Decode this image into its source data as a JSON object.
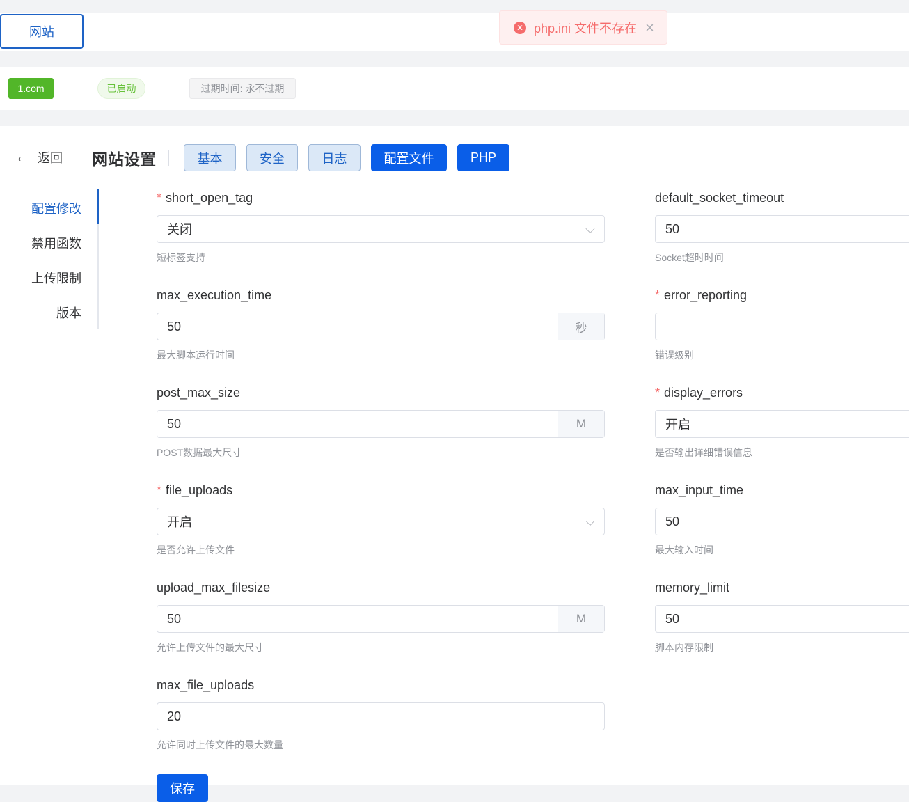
{
  "tabs": {
    "site_label": "网站"
  },
  "toast": {
    "message": "php.ini 文件不存在",
    "icon": "error-circle-icon",
    "close_icon": "close-icon"
  },
  "site": {
    "domain": "1.com",
    "status": "已启动",
    "expire": "过期时间: 永不过期"
  },
  "header": {
    "back_label": "返回",
    "title": "网站设置",
    "buttons": [
      "基本",
      "安全",
      "日志",
      "配置文件",
      "PHP"
    ]
  },
  "sidenav": [
    "配置修改",
    "禁用函数",
    "上传限制",
    "版本"
  ],
  "form": {
    "short_open_tag": {
      "label": "short_open_tag",
      "value": "关闭",
      "help": "短标签支持"
    },
    "max_execution_time": {
      "label": "max_execution_time",
      "value": "50",
      "suffix": "秒",
      "help": "最大脚本运行时间"
    },
    "post_max_size": {
      "label": "post_max_size",
      "value": "50",
      "suffix": "M",
      "help": "POST数据最大尺寸"
    },
    "file_uploads": {
      "label": "file_uploads",
      "value": "开启",
      "help": "是否允许上传文件"
    },
    "upload_max_filesize": {
      "label": "upload_max_filesize",
      "value": "50",
      "suffix": "M",
      "help": "允许上传文件的最大尺寸"
    },
    "max_file_uploads": {
      "label": "max_file_uploads",
      "value": "20",
      "help": "允许同时上传文件的最大数量"
    },
    "default_socket_timeout": {
      "label": "default_socket_timeout",
      "value": "50",
      "help": "Socket超时时间"
    },
    "error_reporting": {
      "label": "error_reporting",
      "value": "",
      "help": "错误级别"
    },
    "display_errors": {
      "label": "display_errors",
      "value": "开启",
      "help": "是否输出详细错误信息"
    },
    "max_input_time": {
      "label": "max_input_time",
      "value": "50",
      "help": "最大输入时间"
    },
    "memory_limit": {
      "label": "memory_limit",
      "value": "50",
      "help": "脚本内存限制"
    },
    "required_mark": "*",
    "save_label": "保存"
  },
  "colors": {
    "primary": "#0a5ee8",
    "success": "#52b629",
    "danger": "#f56c6c"
  }
}
